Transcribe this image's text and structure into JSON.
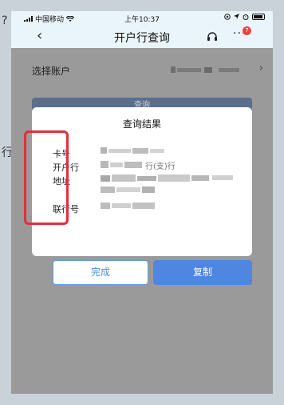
{
  "status_bar": {
    "carrier": "中国移动",
    "time": "上午10:37"
  },
  "nav": {
    "title": "开户行查询",
    "more_badge": "7"
  },
  "background": {
    "left_edge_char": "?",
    "left_edge_char_2": "行"
  },
  "account": {
    "label": "选择账户"
  },
  "query_button": {
    "label": "查询"
  },
  "dialog": {
    "title": "查询结果",
    "fields": [
      {
        "label": "卡号"
      },
      {
        "label": "开户行"
      },
      {
        "label": "地址"
      },
      {
        "label": "联行号"
      }
    ],
    "bank_partial_text": "行(支)行"
  },
  "buttons": {
    "done": "完成",
    "copy": "复制"
  },
  "colors": {
    "highlight_border": "#e0303c",
    "primary_blue": "#4e86e0",
    "badge_red": "#e94444"
  }
}
